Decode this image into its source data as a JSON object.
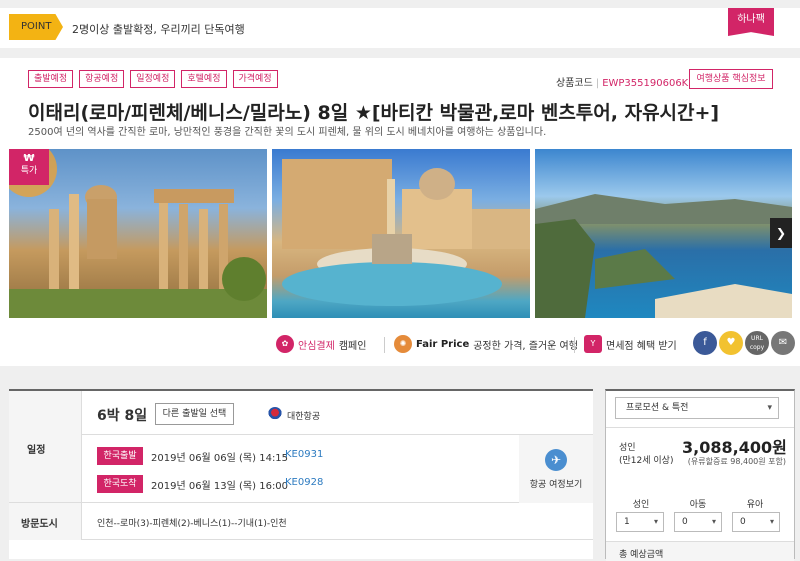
{
  "point": {
    "badge": "POINT",
    "text": "2명이상 출발확정, 우리끼리 단독여행",
    "hana_badge": "하나팩"
  },
  "product": {
    "tags": [
      "출발예정",
      "항공예정",
      "일정예정",
      "호텔예정",
      "가격예정"
    ],
    "code_label": "상품코드",
    "code_value": "EWP355190606KEA",
    "core_info_button": "여행상품 핵심정보",
    "title": "이태리(로마/피렌체/베니스/밀라노) 8일 ★[바티칸 박물관,로마 벤츠투어, 자유시간+]",
    "subtitle": "2500여 년의 역사를 간직한 로마, 낭만적인 풍경을 간직한 꽃의 도시 피렌체, 물 위의 도시 베네치아를 여행하는 상품입니다.",
    "special_badge_symbol": "₩",
    "special_badge": "특가",
    "next_arrow": "❯"
  },
  "benefits": {
    "safe_pay_strong": "안심결제",
    "safe_pay_rest": "캠페인",
    "fair_price_strong": "Fair Price",
    "fair_price_rest": "공정한 가격, 즐거운 여행",
    "dutyfree": "면세점 혜택 받기",
    "dutyfree_icon": "Y",
    "safe_icon": "✿",
    "fair_icon": "✺",
    "social": [
      "f",
      "♥",
      "URL\ncopy",
      "✉"
    ]
  },
  "schedule": {
    "label_schedule": "일정",
    "nights": "6박 8일",
    "other_date_button": "다른 출발일 선택",
    "airline": "대한항공",
    "depart_badge": "한국출발",
    "depart_time": "2019년 06월 06일 (목) 14:15",
    "depart_code": "KE0931",
    "arrive_badge": "한국도착",
    "arrive_time": "2019년 06월 13일 (목) 16:00",
    "arrive_code": "KE0928",
    "route_view": "항공 여정보기",
    "plane_icon": "✈",
    "label_cities": "방문도시",
    "cities": "인천--로마(3)-피렌체(2)-베니스(1)--기내(1)-인천"
  },
  "side": {
    "promo": "프로모션 & 특전",
    "adult_label": "성인",
    "adult_age": "(만12세 이상)",
    "price": "3,088,400원",
    "price_note": "(유류할증료 98,400원 포함)",
    "col_adult": "성인",
    "col_child": "아동",
    "col_infant": "유아",
    "adult_count": "1",
    "child_count": "0",
    "infant_count": "0",
    "bottom_text": "총 예상금액",
    "caret": "▾"
  },
  "colors": {
    "accent": "#d22567",
    "point": "#f3b313",
    "link": "#2d7bc0"
  }
}
